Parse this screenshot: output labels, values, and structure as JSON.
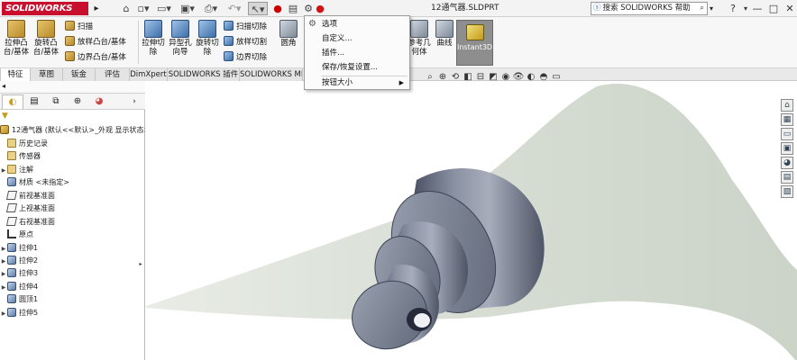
{
  "app": {
    "logo": "SOLIDWORKS",
    "file_title": "12通气器.SLDPRT"
  },
  "quick_access": {
    "home_icon": "home-icon",
    "new_icon": "new-document-icon",
    "open_icon": "open-folder-icon",
    "save_icon": "save-icon",
    "print_icon": "print-icon",
    "undo_icon": "undo-icon",
    "select_icon": "select-arrow-icon",
    "rebuild_icon": "traffic-light-icon",
    "file_props_icon": "file-properties-icon",
    "options_icon": "gear-icon"
  },
  "search": {
    "placeholder": "搜索 SOLIDWORKS 帮助"
  },
  "window_controls": {
    "help": "?",
    "minimize": "—",
    "restore": "□",
    "close": "✕"
  },
  "ribbon": {
    "extruded_boss": "拉伸凸\n台/基体",
    "revolved_boss": "旋转凸\n台/基体",
    "sweep": "扫描",
    "loft": "放样凸台/基体",
    "boundary_boss": "边界凸台/基体",
    "extruded_cut": "拉伸切\n除",
    "hole_wizard": "异型孔\n向导",
    "revolved_cut": "旋转切\n除",
    "swept_cut": "扫描切除",
    "lofted_cut": "放样切割",
    "boundary_cut": "边界切除",
    "fillet": "圆角",
    "ref_geometry": "参考几\n何体",
    "curves": "曲线",
    "instant3d": "Instant3D"
  },
  "tabs": [
    "特征",
    "草图",
    "钣金",
    "评估",
    "DimXpert",
    "SOLIDWORKS 插件",
    "SOLIDWORKS MBD"
  ],
  "options_menu": {
    "items": [
      {
        "label": "选项",
        "icon": "gear-icon"
      },
      {
        "label": "自定义..."
      },
      {
        "label": "插件..."
      },
      {
        "label": "保存/恢复设置..."
      },
      {
        "label": "按钮大小",
        "has_submenu": true
      }
    ]
  },
  "feature_tree": {
    "root": "12通气器 (默认<<默认>_外观 显示状态>",
    "items": [
      {
        "label": "历史记录",
        "icon": "history-icon",
        "expandable": false
      },
      {
        "label": "传感器",
        "icon": "sensor-icon",
        "expandable": false
      },
      {
        "label": "注解",
        "icon": "annotations-icon",
        "expandable": true
      },
      {
        "label": "材质 <未指定>",
        "icon": "material-icon",
        "expandable": false
      },
      {
        "label": "前视基准面",
        "icon": "plane-icon",
        "expandable": false
      },
      {
        "label": "上视基准面",
        "icon": "plane-icon",
        "expandable": false
      },
      {
        "label": "右视基准面",
        "icon": "plane-icon",
        "expandable": false
      },
      {
        "label": "原点",
        "icon": "origin-icon",
        "expandable": false
      },
      {
        "label": "拉伸1",
        "icon": "extrude-icon",
        "expandable": true
      },
      {
        "label": "拉伸2",
        "icon": "extrude-icon",
        "expandable": true
      },
      {
        "label": "拉伸3",
        "icon": "extrude-icon",
        "expandable": true
      },
      {
        "label": "拉伸4",
        "icon": "extrude-icon",
        "expandable": true
      },
      {
        "label": "圆顶1",
        "icon": "dome-icon",
        "expandable": false
      },
      {
        "label": "拉伸5",
        "icon": "extrude-icon",
        "expandable": true
      }
    ]
  },
  "colors": {
    "accent": "#c8102e",
    "model": "#6f7686",
    "background_shape": "#d5dbd1"
  }
}
